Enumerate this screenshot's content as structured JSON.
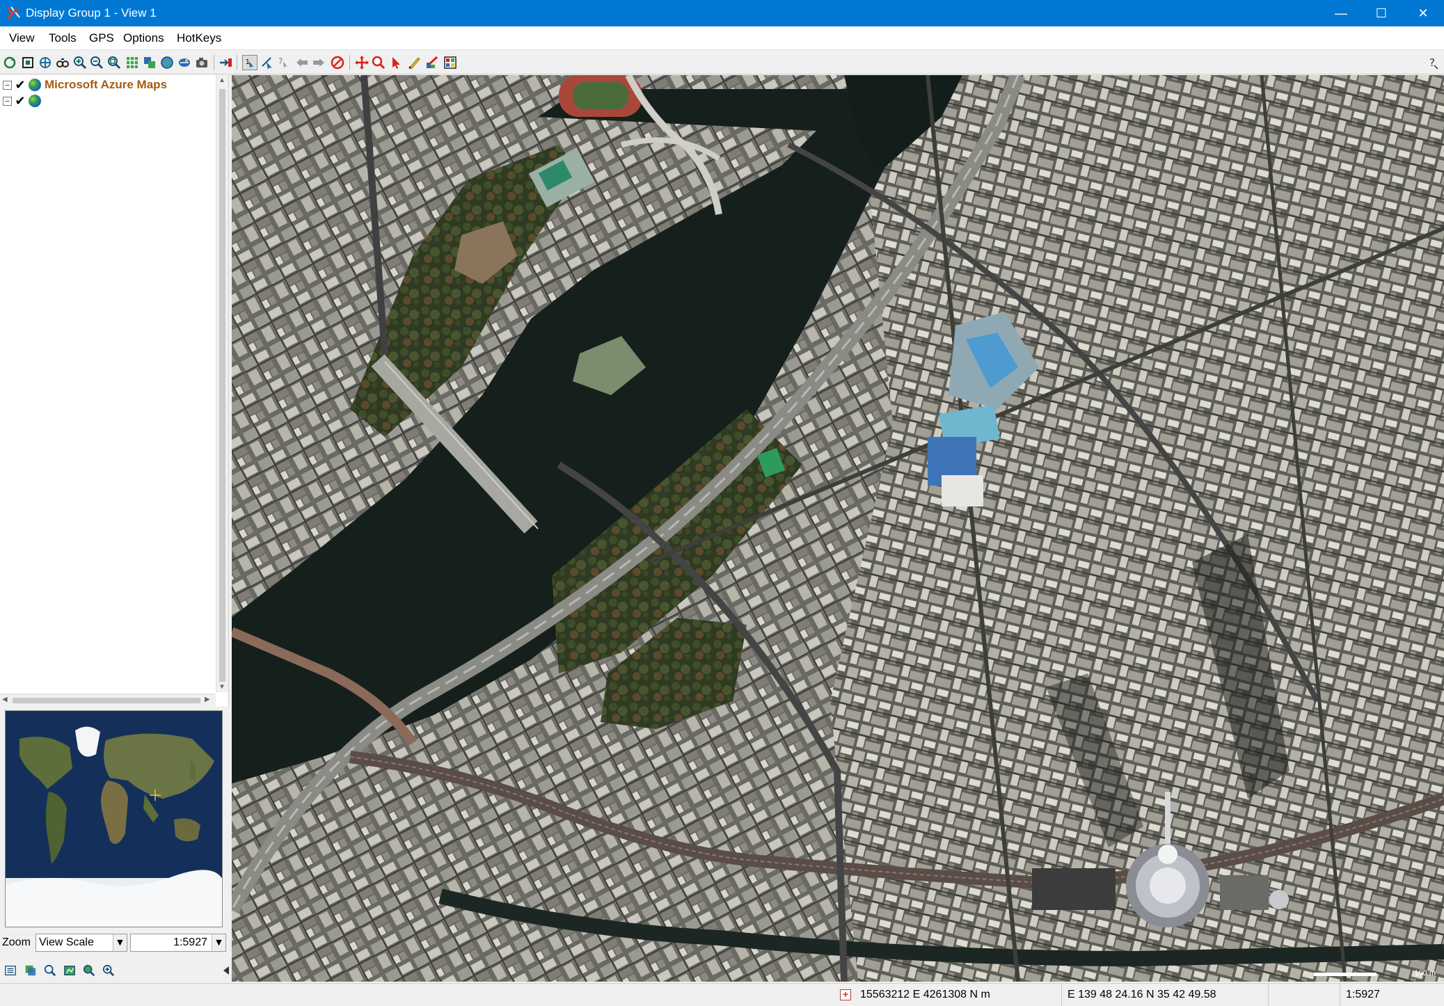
{
  "window": {
    "title": "Display Group 1 - View 1",
    "controls": {
      "minimize": "—",
      "maximize": "☐",
      "close": "✕"
    }
  },
  "menu": [
    "View",
    "Tools",
    "GPS",
    "Options",
    "HotKeys"
  ],
  "toolbar": {
    "icons": [
      "refresh-icon",
      "full-extent-icon",
      "pan-icon",
      "zoom-previous-icon",
      "zoom-in-icon",
      "zoom-out-icon",
      "zoom-fit-icon",
      "grid-icon",
      "layers-icon",
      "globe-icon",
      "projection-icon",
      "capture-icon",
      "link-icon",
      "select-icon",
      "measure-icon",
      "query-icon",
      "back-icon",
      "forward-icon",
      "stop-icon",
      "move-icon",
      "zoom-box-icon",
      "pointer-icon",
      "draw-icon",
      "edit-icon",
      "style-icon",
      "help-icon"
    ],
    "accent_red": "#d8221a"
  },
  "tree": {
    "layers": [
      {
        "label": "Microsoft Azure Maps",
        "checked": true,
        "icon": "globe-icon"
      },
      {
        "label": "",
        "checked": true,
        "icon": "globe-icon"
      }
    ]
  },
  "zoom": {
    "label": "Zoom",
    "mode": "View Scale",
    "scale": "1:5927"
  },
  "map": {
    "scale_text": "100 m"
  },
  "status": {
    "projected": "15563212 E  4261308 N m",
    "geographic": "E 139 48 24.16  N 35 42 49.58",
    "scale": "1:5927"
  }
}
